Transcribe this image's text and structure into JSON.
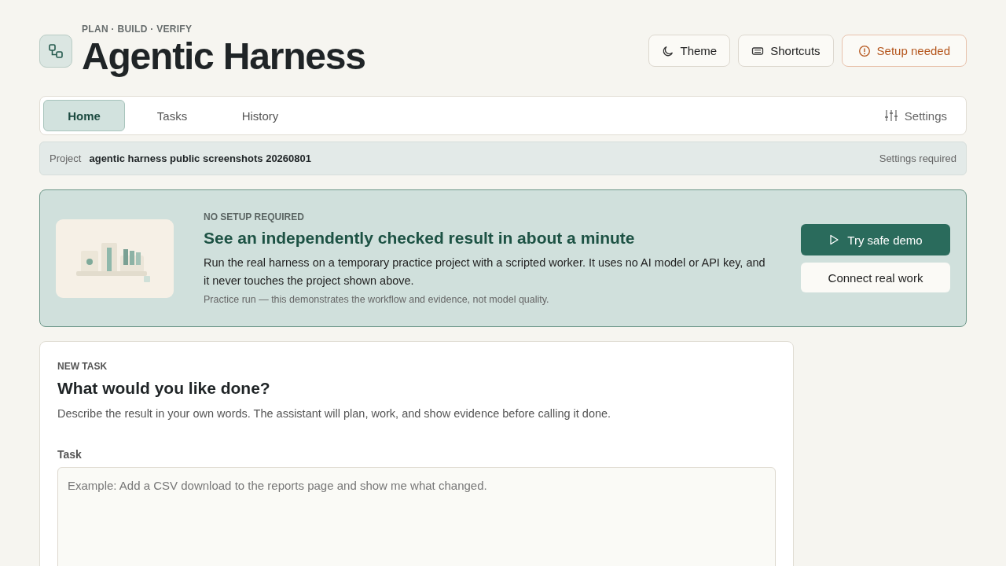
{
  "header": {
    "eyebrow": "PLAN · BUILD · VERIFY",
    "title": "Agentic Harness"
  },
  "actions": [
    {
      "kind": "theme",
      "label": "Theme"
    },
    {
      "kind": "shortcuts",
      "label": "Shortcuts"
    },
    {
      "kind": "warning",
      "label": "Setup needed"
    }
  ],
  "tabs": [
    {
      "label": "Home",
      "selected": true
    },
    {
      "label": "Tasks",
      "selected": false
    },
    {
      "label": "History",
      "selected": false
    }
  ],
  "settings": {
    "label": "Settings"
  },
  "project": {
    "label": "Project",
    "name": "agentic harness public screenshots 20260801",
    "status": "Settings required"
  },
  "banner": {
    "eyebrow": "NO SETUP REQUIRED",
    "title": "See an independently checked result in about a minute",
    "body": "Run the real harness on a temporary practice project with a scripted worker. It uses no AI model or API key, and it never touches the project shown above.",
    "note": "Practice run — this demonstrates the workflow and evidence, not model quality.",
    "primary": "Try safe demo",
    "secondary": "Connect real work"
  },
  "task": {
    "eyebrow": "NEW TASK",
    "title": "What would you like done?",
    "description": "Describe the result in your own words. The assistant will plan, work, and show evidence before calling it done.",
    "field_label": "Task",
    "placeholder": "Example: Add a CSV download to the reports page and show me what changed."
  }
}
